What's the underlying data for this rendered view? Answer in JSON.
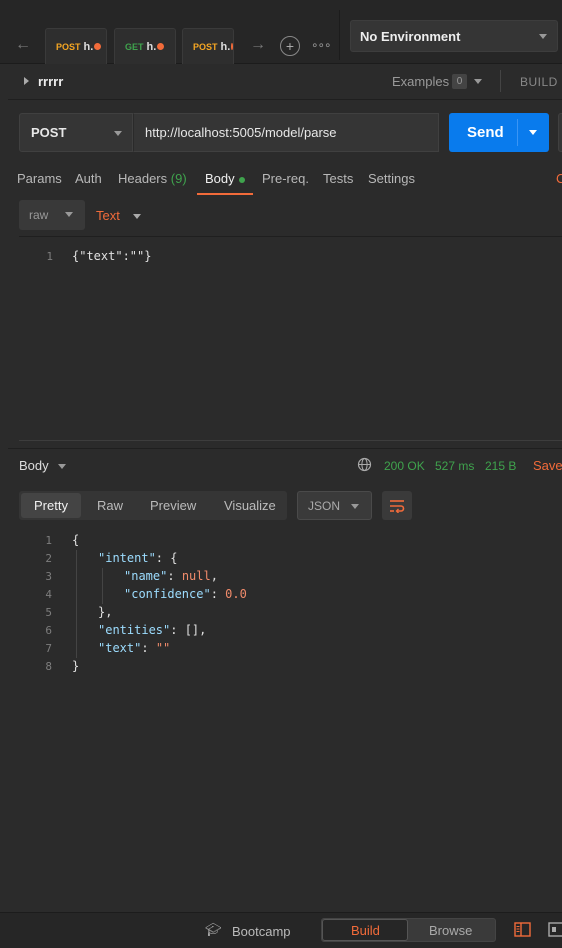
{
  "tabs": [
    {
      "method": "POST",
      "name": "h."
    },
    {
      "method": "GET",
      "name": "h."
    },
    {
      "method": "POST",
      "name": "h."
    }
  ],
  "environment": {
    "label": "No Environment"
  },
  "collection": {
    "name": "rrrrr",
    "examples_label": "Examples",
    "examples_count": "0",
    "build_label": "BUILD"
  },
  "request": {
    "method": "POST",
    "url": "http://localhost:5005/model/parse",
    "send_label": "Send"
  },
  "request_tabs": {
    "params": "Params",
    "auth": "Auth",
    "headers": "Headers",
    "headers_count": "(9)",
    "body": "Body",
    "prereq": "Pre-req.",
    "tests": "Tests",
    "settings": "Settings",
    "cookies_stub": "C"
  },
  "body_options": {
    "mode": "raw",
    "type": "Text"
  },
  "request_body": {
    "line_numbers": [
      "1"
    ],
    "lines": [
      "{\"text\":\"\"}"
    ]
  },
  "response": {
    "label": "Body",
    "status": "200 OK",
    "time": "527 ms",
    "size": "215 B",
    "save_label": "Save",
    "view_tabs": [
      "Pretty",
      "Raw",
      "Preview",
      "Visualize"
    ],
    "format": "JSON",
    "line_numbers": [
      "1",
      "2",
      "3",
      "4",
      "5",
      "6",
      "7",
      "8"
    ],
    "json": {
      "l1": "{",
      "intent_key": "\"intent\"",
      "intent_open": ": {",
      "name_key": "\"name\"",
      "name_val": "null",
      "conf_key": "\"confidence\"",
      "conf_val": "0.0",
      "close_inner": "},",
      "entities_key": "\"entities\"",
      "entities_val": ": [],",
      "text_key": "\"text\"",
      "text_val": "\"\"",
      "l8": "}"
    }
  },
  "footer": {
    "bootcamp": "Bootcamp",
    "build": "Build",
    "browse": "Browse"
  },
  "colors": {
    "accent": "#f26b3a",
    "send": "#097bed",
    "status_ok": "#3fa34d"
  }
}
